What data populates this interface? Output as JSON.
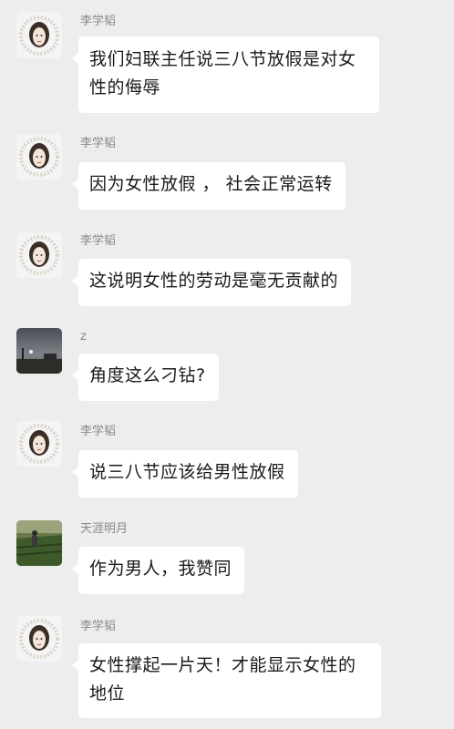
{
  "messages": [
    {
      "sender": "李学韬",
      "avatar": "lady-sketch-avatar",
      "text": "我们妇联主任说三八节放假是对女性的侮辱"
    },
    {
      "sender": "李学韬",
      "avatar": "lady-sketch-avatar",
      "text": "因为女性放假 ， 社会正常运转"
    },
    {
      "sender": "李学韬",
      "avatar": "lady-sketch-avatar",
      "text": "这说明女性的劳动是毫无贡献的"
    },
    {
      "sender": "z",
      "avatar": "dusk-landscape-avatar",
      "text": "角度这么刁钻?"
    },
    {
      "sender": "李学韬",
      "avatar": "lady-sketch-avatar",
      "text": "说三八节应该给男性放假"
    },
    {
      "sender": "天涯明月",
      "avatar": "field-photo-avatar",
      "text": "作为男人，我赞同"
    },
    {
      "sender": "李学韬",
      "avatar": "lady-sketch-avatar",
      "text": "女性撑起一片天！才能显示女性的地位"
    }
  ]
}
